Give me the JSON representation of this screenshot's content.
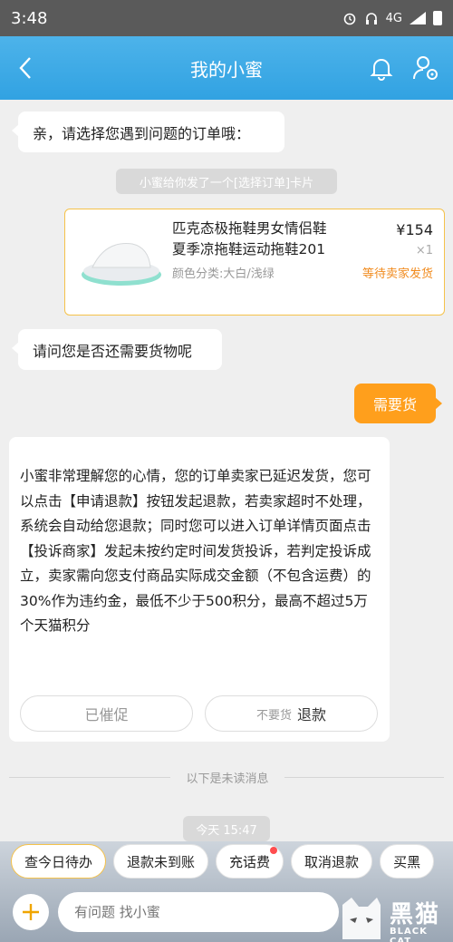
{
  "status_bar": {
    "time": "3:48",
    "network": "4G"
  },
  "header": {
    "title": "我的小蜜"
  },
  "messages": {
    "greeting": "亲，请选择您遇到问题的订单哦：",
    "card_notice": "小蜜给你发了一个[选择订单]卡片",
    "ask_goods": "请问您是否还需要货物呢",
    "user_reply": "需要货",
    "reply_text": "小蜜非常理解您的心情，您的订单卖家已延迟发货，您可以点击【申请退款】按钮发起退款，若卖家超时不处理，系统会自动给您退款；同时您可以进入订单详情页面点击【投诉商家】发起未按约定时间发货投诉，若判定投诉成立，卖家需向您支付商品实际成交金额（不包含运费）的30%作为违约金，最低不少于500积分，最高不超过5万个天猫积分",
    "btn_urged": "已催促",
    "btn_refund_small": "不要货",
    "btn_refund": "退款",
    "unread_divider": "以下是未读消息",
    "timestamp": "今天 15:47"
  },
  "order": {
    "name_line1": "匹克态极拖鞋男女情侣鞋",
    "name_line2": "夏季凉拖鞋运动拖鞋201",
    "price": "¥154",
    "qty": "×1",
    "spec": "颜色分类:大白/浅绿",
    "status": "等待卖家发货"
  },
  "quick_replies": [
    {
      "label": "查今日待办"
    },
    {
      "label": "退款未到账"
    },
    {
      "label": "充话费"
    },
    {
      "label": "取消退款"
    },
    {
      "label": "买黑"
    }
  ],
  "input": {
    "placeholder": "有问题 找小蜜"
  },
  "watermark": {
    "text": "黑猫",
    "sub": "BLACK CAT"
  },
  "colors": {
    "header_blue": "#31a2e2",
    "accent_orange": "#ff9f1c",
    "card_border": "#f5c24a",
    "status_orange": "#f18b1e"
  }
}
